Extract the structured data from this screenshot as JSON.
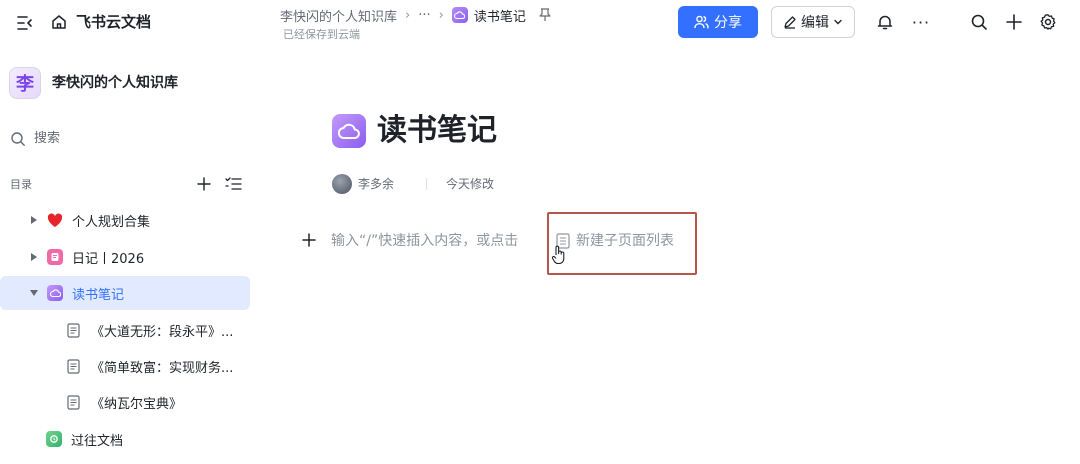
{
  "header": {
    "app_title": "飞书云文档",
    "breadcrumb": {
      "space": "李快闪的个人知识库",
      "ellipsis": "···",
      "current": "读书笔记"
    },
    "save_status": "已经保存到云端",
    "share_label": "分享",
    "edit_label": "编辑",
    "more_label": "···"
  },
  "sidebar": {
    "space_avatar": "李",
    "space_name": "李快闪的个人知识库",
    "search_label": "搜索",
    "toc_label": "目录",
    "items": [
      {
        "label": "个人规划合集",
        "icon": "heart-icon",
        "expanded": false
      },
      {
        "label": "日记丨2026",
        "icon": "journal-icon",
        "expanded": false
      },
      {
        "label": "读书笔记",
        "icon": "cloud-icon",
        "expanded": true,
        "selected": true
      },
      {
        "label": "《大道无形：段永平》...",
        "icon": "document-icon",
        "child": true
      },
      {
        "label": "《简单致富：实现财务...",
        "icon": "document-icon",
        "child": true
      },
      {
        "label": "《纳瓦尔宝典》",
        "icon": "document-icon",
        "child": true
      },
      {
        "label": "过往文档",
        "icon": "archive-icon",
        "expanded": false
      }
    ]
  },
  "document": {
    "title": "读书笔记",
    "author": "李多余",
    "modified": "今天修改",
    "placeholder": "输入“/”快速插入内容，或点击",
    "subpage_button": "新建子页面列表"
  },
  "colors": {
    "accent": "#3370ff",
    "selected_bg": "#e1eaff",
    "highlight_border": "#b5564a",
    "doc_icon": "#8b5cf0"
  }
}
